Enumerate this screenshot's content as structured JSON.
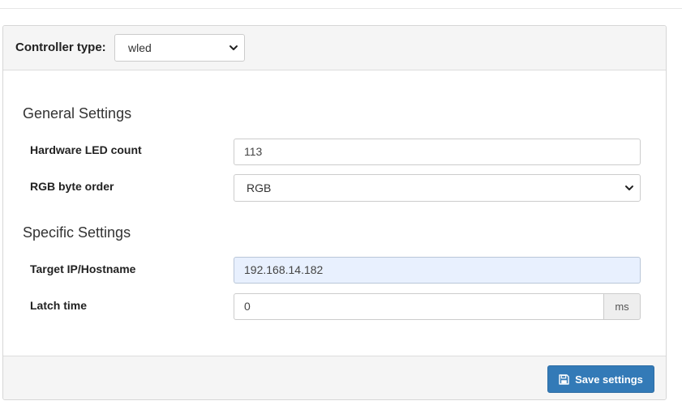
{
  "controller": {
    "label": "Controller type:",
    "selected": "wled"
  },
  "general": {
    "title": "General Settings",
    "led_count": {
      "label": "Hardware LED count",
      "value": "113"
    },
    "byte_order": {
      "label": "RGB byte order",
      "selected": "RGB"
    }
  },
  "specific": {
    "title": "Specific Settings",
    "target": {
      "label": "Target IP/Hostname",
      "value": "192.168.14.182"
    },
    "latch": {
      "label": "Latch time",
      "value": "0",
      "unit": "ms"
    }
  },
  "footer": {
    "save_label": "Save settings"
  },
  "icons": {
    "select_arrow": "chevron-down-icon",
    "save": "floppy-disk-icon"
  },
  "colors": {
    "primary": "#337ab7",
    "autofill_bg": "#e8f0fe"
  }
}
